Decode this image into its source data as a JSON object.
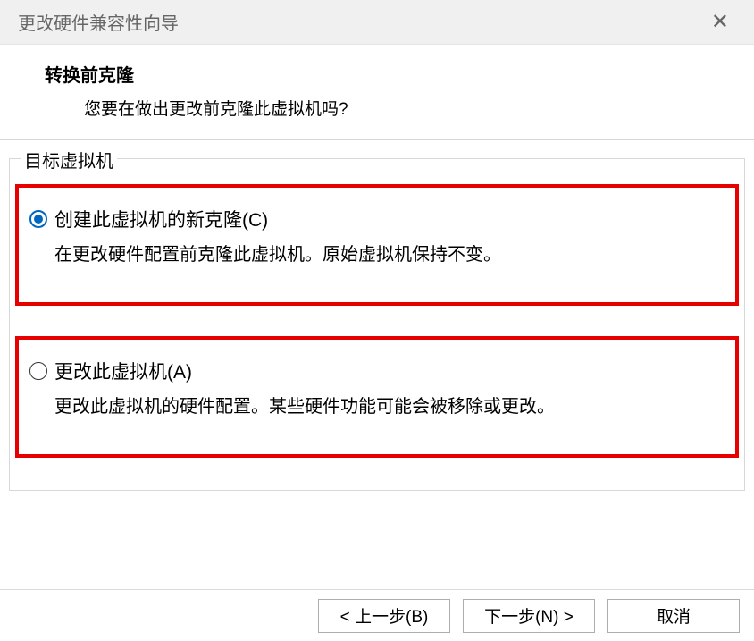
{
  "titlebar": {
    "title": "更改硬件兼容性向导"
  },
  "header": {
    "title": "转换前克隆",
    "subtitle": "您要在做出更改前克隆此虚拟机吗?"
  },
  "fieldset": {
    "label": "目标虚拟机"
  },
  "options": {
    "clone": {
      "label": "创建此虚拟机的新克隆(C)",
      "desc": "在更改硬件配置前克隆此虚拟机。原始虚拟机保持不变。"
    },
    "alter": {
      "label": "更改此虚拟机(A)",
      "desc": "更改此虚拟机的硬件配置。某些硬件功能可能会被移除或更改。"
    }
  },
  "buttons": {
    "back": "< 上一步(B)",
    "next": "下一步(N) >",
    "cancel": "取消"
  }
}
